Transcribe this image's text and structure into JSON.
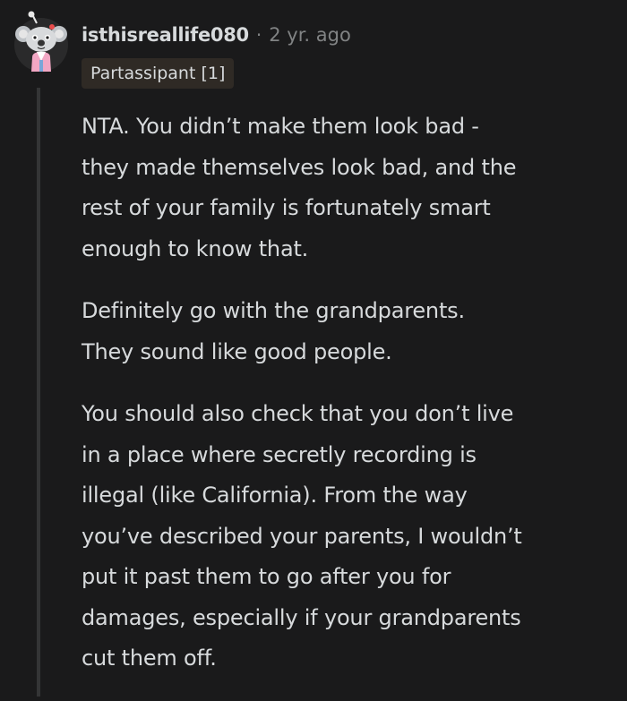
{
  "comment": {
    "username": "isthisreallife080",
    "separator": "·",
    "timestamp": "2 yr. ago",
    "flair": "Partassipant [1]",
    "avatar_icon": "snoo-koala-avatar-icon",
    "paragraphs": [
      {
        "lines": [
          "NTA. You didn’t make them look bad -",
          "they made themselves look bad, and the",
          "rest of your family is fortunately smart",
          "enough to know that."
        ]
      },
      {
        "lines": [
          "Definitely go with the grandparents.",
          "They sound like good people."
        ]
      },
      {
        "lines": [
          "You should also check that you don’t live",
          "in a place where secretly recording is",
          "illegal (like California). From the way",
          "you’ve described your parents, I wouldn’t",
          "put it past them to go after you for",
          "damages, especially if your grandparents",
          "cut them off."
        ]
      }
    ]
  },
  "colors": {
    "background": "#1a1a1b",
    "text": "#d7dadc",
    "meta": "#818384",
    "flair_bg": "#2f2a25",
    "thread_line": "#343536"
  }
}
